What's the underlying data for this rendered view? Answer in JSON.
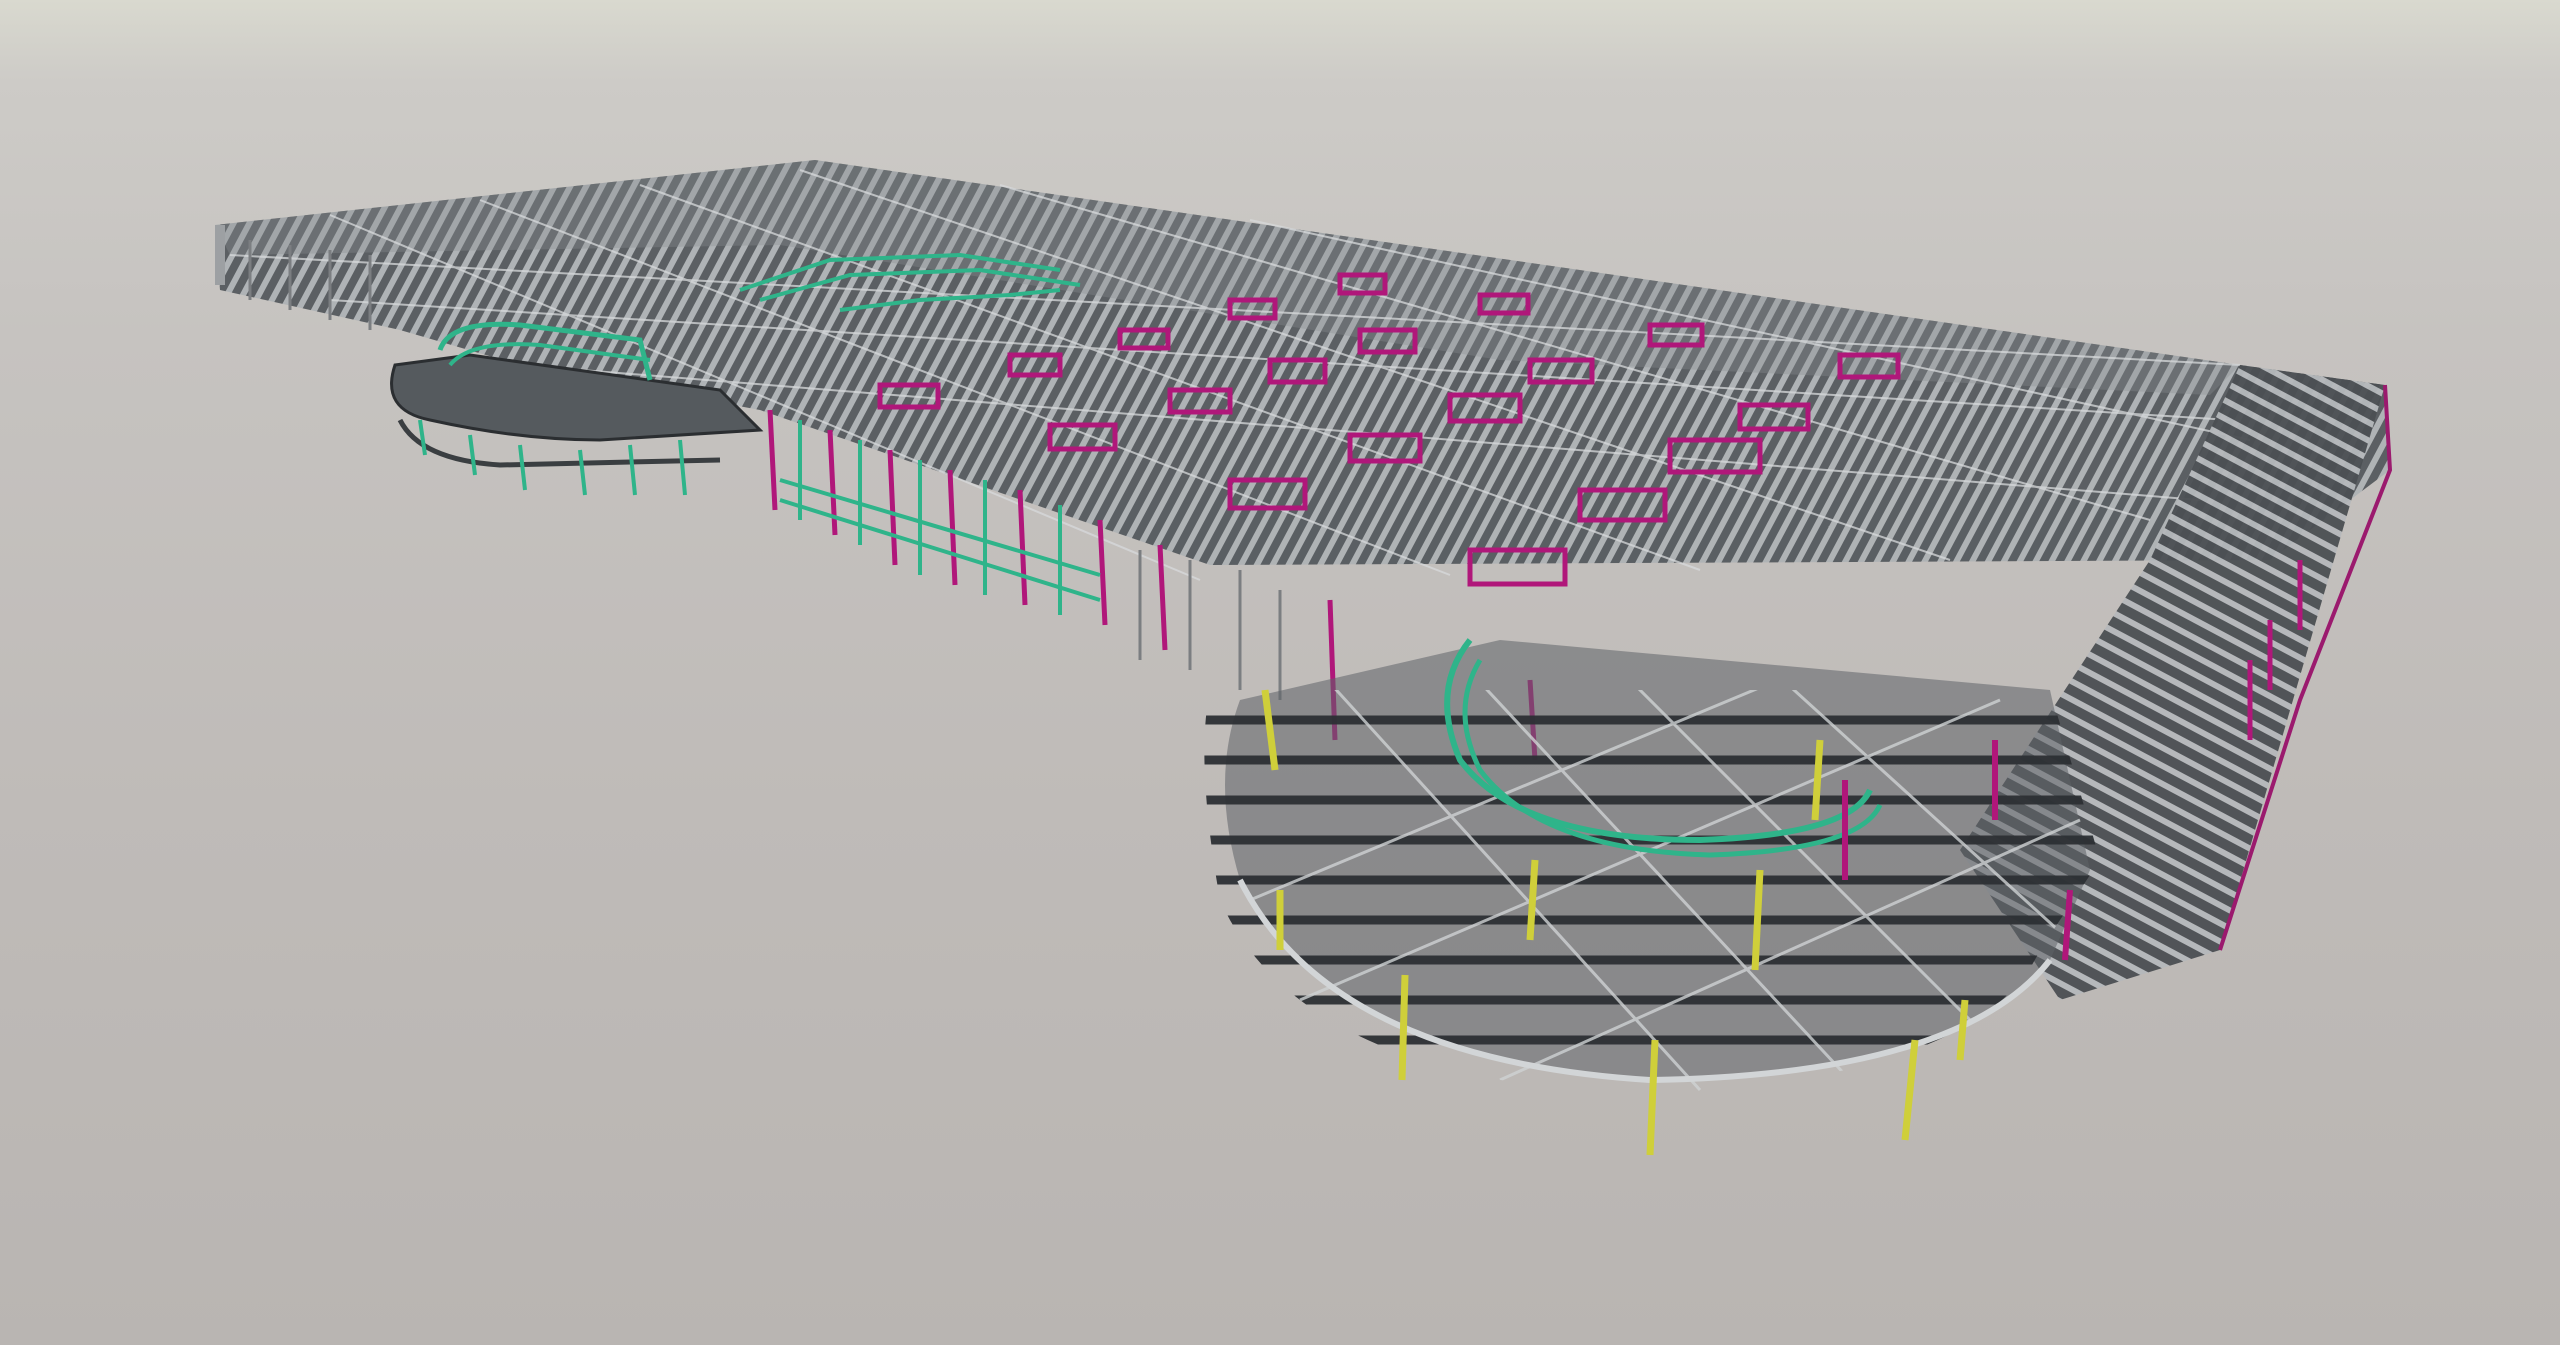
{
  "viewport": {
    "background_top": "#d9d9cf",
    "background_bottom": "#b9b5b2"
  },
  "model": {
    "kind": "3d-structural-steel-frame",
    "colors": {
      "beam": "#3f4347",
      "beam_highlight": "#c9ccce",
      "column": "#a8a8aa",
      "brace_magenta": "#b0177a",
      "curved_green": "#2fb48a",
      "column_yellow": "#cfcf3a"
    },
    "icons": [
      "structural-frame-icon"
    ]
  }
}
